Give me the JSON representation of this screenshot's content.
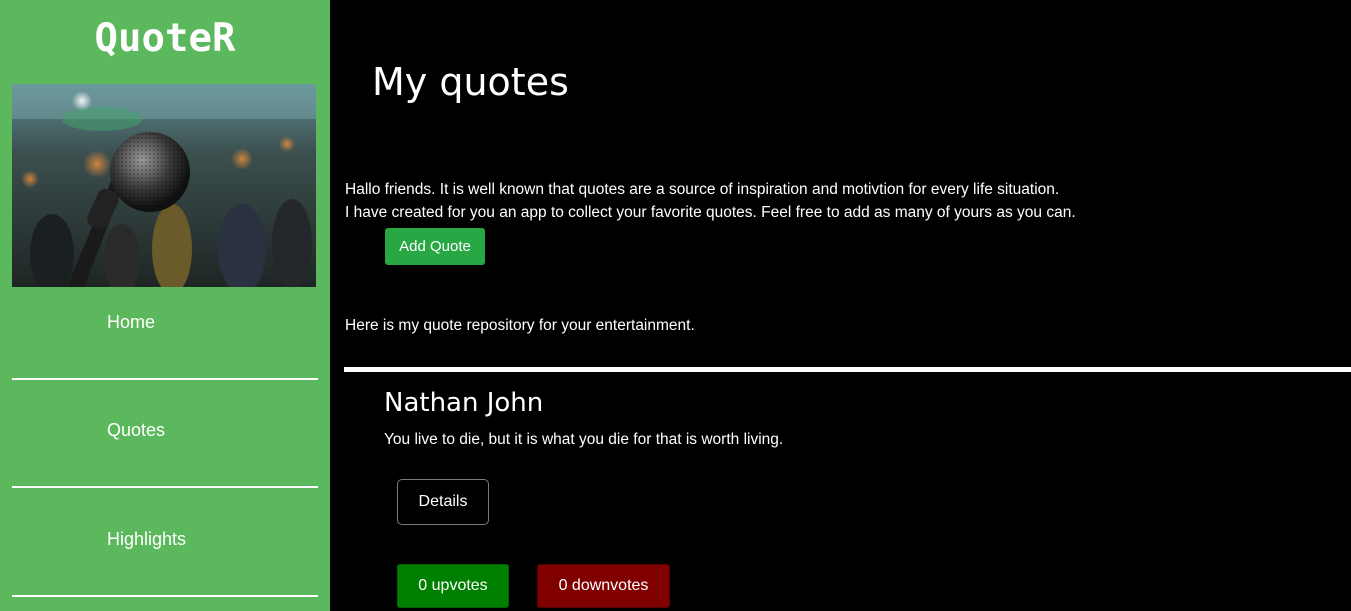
{
  "sidebar": {
    "brand": "QuoteR",
    "hero_image": "microphone-concert-photo",
    "nav": [
      {
        "label": "Home"
      },
      {
        "label": "Quotes"
      },
      {
        "label": "Highlights"
      }
    ]
  },
  "main": {
    "title": "My quotes",
    "intro_line1": "Hallo friends. It is well known that quotes are a source of inspiration and motivtion for every life situation.",
    "intro_line2": "I have created for you an app to collect your favorite quotes. Feel free to add as many of yours as you can.",
    "add_button": "Add Quote",
    "repo_text": "Here is my quote repository for your entertainment."
  },
  "quote": {
    "author": "Nathan John",
    "text": "You live to die, but it is what you die for that is worth living.",
    "details_button": "Details",
    "upvotes_label": "0 upvotes",
    "downvotes_label": "0 downvotes"
  },
  "colors": {
    "sidebar": "#5cb85c",
    "background": "#000000",
    "add_button": "#28a745",
    "upvote": "#008000",
    "downvote": "#800000"
  }
}
